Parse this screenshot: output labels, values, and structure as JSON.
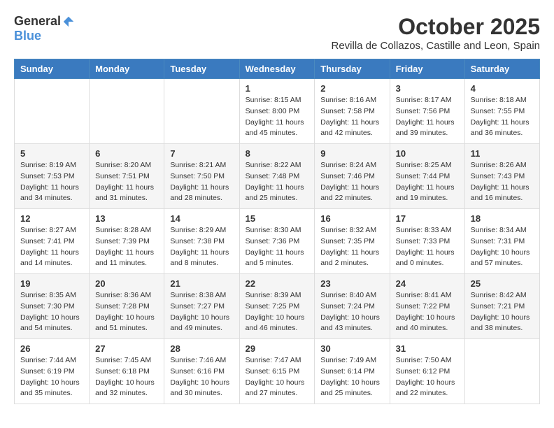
{
  "logo": {
    "general": "General",
    "blue": "Blue"
  },
  "title": "October 2025",
  "location": "Revilla de Collazos, Castille and Leon, Spain",
  "weekdays": [
    "Sunday",
    "Monday",
    "Tuesday",
    "Wednesday",
    "Thursday",
    "Friday",
    "Saturday"
  ],
  "weeks": [
    [
      {
        "day": "",
        "info": ""
      },
      {
        "day": "",
        "info": ""
      },
      {
        "day": "",
        "info": ""
      },
      {
        "day": "1",
        "info": "Sunrise: 8:15 AM\nSunset: 8:00 PM\nDaylight: 11 hours and 45 minutes."
      },
      {
        "day": "2",
        "info": "Sunrise: 8:16 AM\nSunset: 7:58 PM\nDaylight: 11 hours and 42 minutes."
      },
      {
        "day": "3",
        "info": "Sunrise: 8:17 AM\nSunset: 7:56 PM\nDaylight: 11 hours and 39 minutes."
      },
      {
        "day": "4",
        "info": "Sunrise: 8:18 AM\nSunset: 7:55 PM\nDaylight: 11 hours and 36 minutes."
      }
    ],
    [
      {
        "day": "5",
        "info": "Sunrise: 8:19 AM\nSunset: 7:53 PM\nDaylight: 11 hours and 34 minutes."
      },
      {
        "day": "6",
        "info": "Sunrise: 8:20 AM\nSunset: 7:51 PM\nDaylight: 11 hours and 31 minutes."
      },
      {
        "day": "7",
        "info": "Sunrise: 8:21 AM\nSunset: 7:50 PM\nDaylight: 11 hours and 28 minutes."
      },
      {
        "day": "8",
        "info": "Sunrise: 8:22 AM\nSunset: 7:48 PM\nDaylight: 11 hours and 25 minutes."
      },
      {
        "day": "9",
        "info": "Sunrise: 8:24 AM\nSunset: 7:46 PM\nDaylight: 11 hours and 22 minutes."
      },
      {
        "day": "10",
        "info": "Sunrise: 8:25 AM\nSunset: 7:44 PM\nDaylight: 11 hours and 19 minutes."
      },
      {
        "day": "11",
        "info": "Sunrise: 8:26 AM\nSunset: 7:43 PM\nDaylight: 11 hours and 16 minutes."
      }
    ],
    [
      {
        "day": "12",
        "info": "Sunrise: 8:27 AM\nSunset: 7:41 PM\nDaylight: 11 hours and 14 minutes."
      },
      {
        "day": "13",
        "info": "Sunrise: 8:28 AM\nSunset: 7:39 PM\nDaylight: 11 hours and 11 minutes."
      },
      {
        "day": "14",
        "info": "Sunrise: 8:29 AM\nSunset: 7:38 PM\nDaylight: 11 hours and 8 minutes."
      },
      {
        "day": "15",
        "info": "Sunrise: 8:30 AM\nSunset: 7:36 PM\nDaylight: 11 hours and 5 minutes."
      },
      {
        "day": "16",
        "info": "Sunrise: 8:32 AM\nSunset: 7:35 PM\nDaylight: 11 hours and 2 minutes."
      },
      {
        "day": "17",
        "info": "Sunrise: 8:33 AM\nSunset: 7:33 PM\nDaylight: 11 hours and 0 minutes."
      },
      {
        "day": "18",
        "info": "Sunrise: 8:34 AM\nSunset: 7:31 PM\nDaylight: 10 hours and 57 minutes."
      }
    ],
    [
      {
        "day": "19",
        "info": "Sunrise: 8:35 AM\nSunset: 7:30 PM\nDaylight: 10 hours and 54 minutes."
      },
      {
        "day": "20",
        "info": "Sunrise: 8:36 AM\nSunset: 7:28 PM\nDaylight: 10 hours and 51 minutes."
      },
      {
        "day": "21",
        "info": "Sunrise: 8:38 AM\nSunset: 7:27 PM\nDaylight: 10 hours and 49 minutes."
      },
      {
        "day": "22",
        "info": "Sunrise: 8:39 AM\nSunset: 7:25 PM\nDaylight: 10 hours and 46 minutes."
      },
      {
        "day": "23",
        "info": "Sunrise: 8:40 AM\nSunset: 7:24 PM\nDaylight: 10 hours and 43 minutes."
      },
      {
        "day": "24",
        "info": "Sunrise: 8:41 AM\nSunset: 7:22 PM\nDaylight: 10 hours and 40 minutes."
      },
      {
        "day": "25",
        "info": "Sunrise: 8:42 AM\nSunset: 7:21 PM\nDaylight: 10 hours and 38 minutes."
      }
    ],
    [
      {
        "day": "26",
        "info": "Sunrise: 7:44 AM\nSunset: 6:19 PM\nDaylight: 10 hours and 35 minutes."
      },
      {
        "day": "27",
        "info": "Sunrise: 7:45 AM\nSunset: 6:18 PM\nDaylight: 10 hours and 32 minutes."
      },
      {
        "day": "28",
        "info": "Sunrise: 7:46 AM\nSunset: 6:16 PM\nDaylight: 10 hours and 30 minutes."
      },
      {
        "day": "29",
        "info": "Sunrise: 7:47 AM\nSunset: 6:15 PM\nDaylight: 10 hours and 27 minutes."
      },
      {
        "day": "30",
        "info": "Sunrise: 7:49 AM\nSunset: 6:14 PM\nDaylight: 10 hours and 25 minutes."
      },
      {
        "day": "31",
        "info": "Sunrise: 7:50 AM\nSunset: 6:12 PM\nDaylight: 10 hours and 22 minutes."
      },
      {
        "day": "",
        "info": ""
      }
    ]
  ]
}
